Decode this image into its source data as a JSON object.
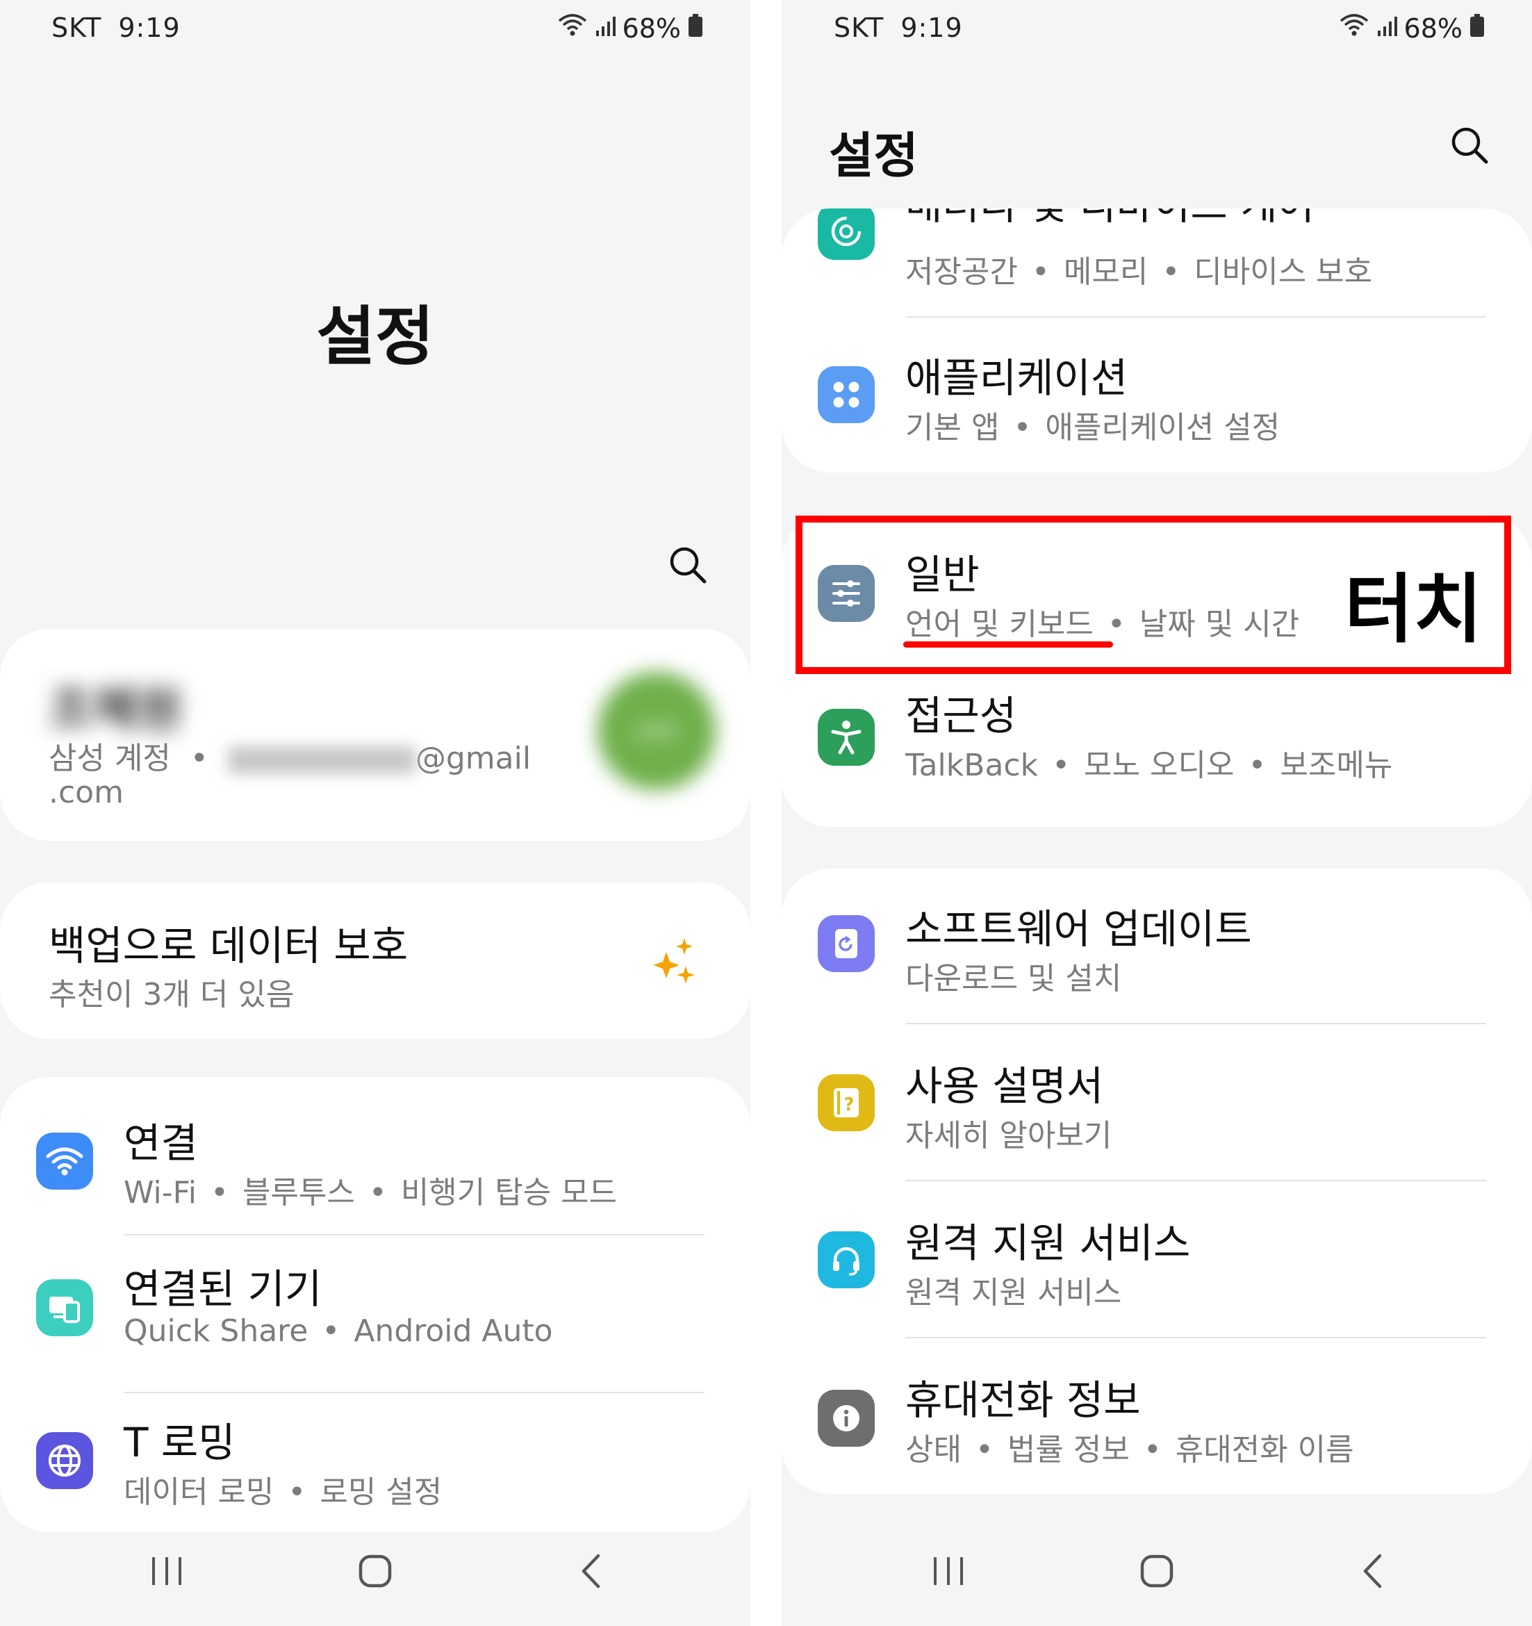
{
  "status": {
    "carrier": "SKT",
    "time": "9:19",
    "battery": "68%"
  },
  "left": {
    "title": "설정",
    "account": {
      "name": "조혜원",
      "label": "삼성 계정",
      "email_domain": "@gmail",
      "email_tld": ".com",
      "avatar_text": "JHW"
    },
    "backup": {
      "title": "백업으로 데이터 보호",
      "sub": "추천이 3개 더 있음"
    },
    "items": [
      {
        "title": "연결",
        "sub": [
          "Wi-Fi",
          "블루투스",
          "비행기 탑승 모드"
        ],
        "icon": "wifi-icon",
        "color": "#3d8cf7"
      },
      {
        "title": "연결된 기기",
        "sub": [
          "Quick Share",
          "Android Auto"
        ],
        "icon": "connected-devices-icon",
        "color": "#3ccfbf"
      },
      {
        "title": "T 로밍",
        "sub": [
          "데이터 로밍",
          "로밍 설정"
        ],
        "icon": "globe-icon",
        "color": "#5b55e0"
      }
    ]
  },
  "right": {
    "title": "설정",
    "items": [
      {
        "title": "배터리 및 디바이스 케어",
        "sub": [
          "저장공간",
          "메모리",
          "디바이스 보호"
        ],
        "icon": "device-care-icon",
        "color": "#19b9a3"
      },
      {
        "title": "애플리케이션",
        "sub": [
          "기본 앱",
          "애플리케이션 설정"
        ],
        "icon": "apps-icon",
        "color": "#5b9cf5"
      },
      {
        "title": "일반",
        "sub": [
          "언어 및 키보드",
          "날짜 및 시간"
        ],
        "icon": "general-sliders-icon",
        "color": "#6c8ba6"
      },
      {
        "title": "접근성",
        "sub": [
          "TalkBack",
          "모노 오디오",
          "보조메뉴"
        ],
        "icon": "accessibility-icon",
        "color": "#2c9f5b"
      },
      {
        "title": "소프트웨어 업데이트",
        "sub": [
          "다운로드 및 설치"
        ],
        "icon": "software-update-icon",
        "color": "#7d7cf2"
      },
      {
        "title": "사용 설명서",
        "sub": [
          "자세히 알아보기"
        ],
        "icon": "user-manual-icon",
        "color": "#e0b914"
      },
      {
        "title": "원격 지원 서비스",
        "sub": [
          "원격 지원 서비스"
        ],
        "icon": "headset-icon",
        "color": "#1fb8e0"
      },
      {
        "title": "휴대전화 정보",
        "sub": [
          "상태",
          "법률 정보",
          "휴대전화 이름"
        ],
        "icon": "info-icon",
        "color": "#6e6e6e"
      }
    ],
    "annotation": "터치",
    "annotation_color": "#ff0000"
  }
}
